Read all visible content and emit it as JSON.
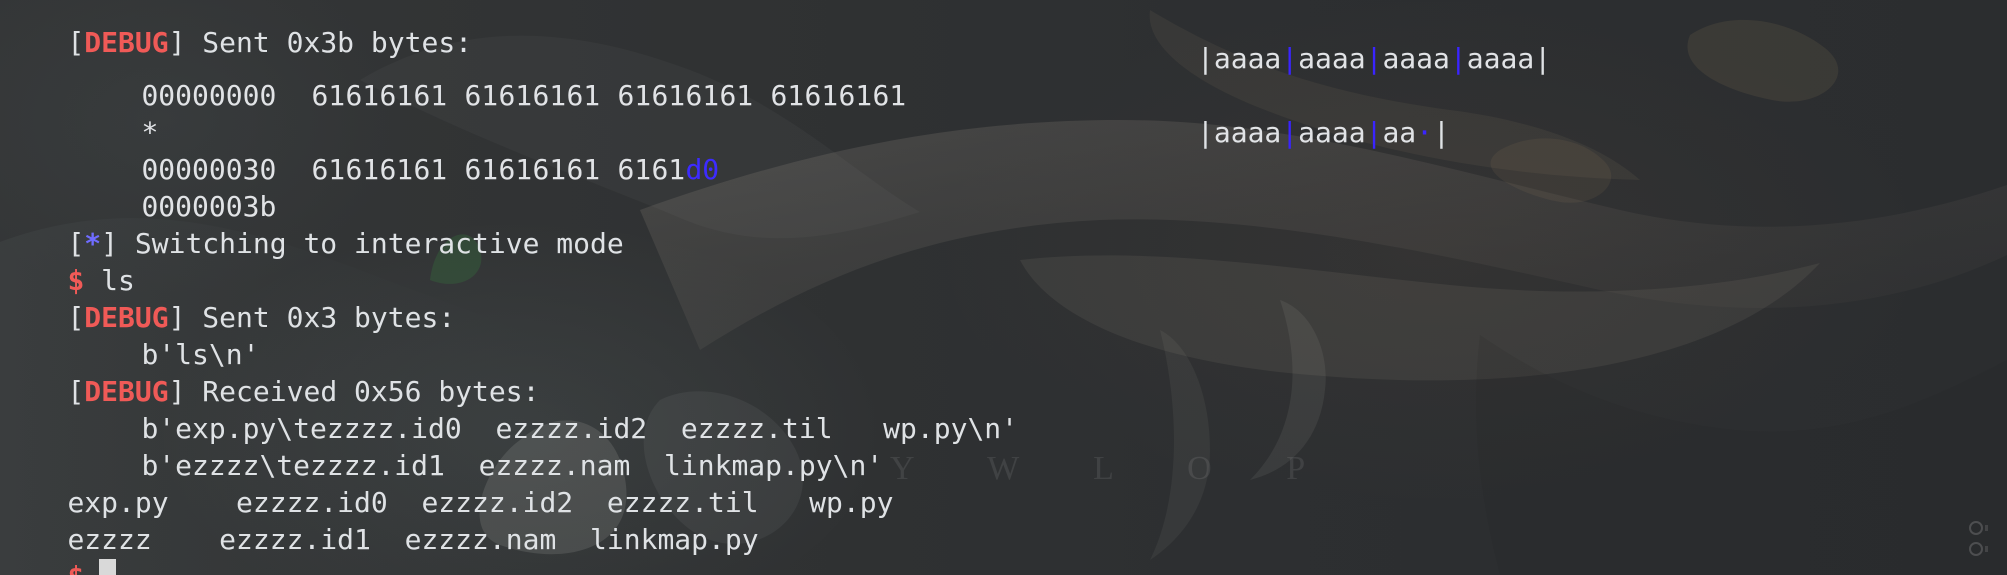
{
  "terminal": {
    "lines": {
      "sent_0x3b": {
        "open": "[",
        "tag": "DEBUG",
        "close": "]",
        "message": " Sent 0x3b bytes:"
      },
      "hex_row_0": {
        "offset": "00000000",
        "bytes_1": [
          "61",
          "61",
          "61",
          "61"
        ],
        "bytes_2": [
          "61",
          "61",
          "61",
          "61"
        ],
        "bytes_3": [
          "61",
          "61",
          "61",
          "61"
        ],
        "bytes_4": [
          "61",
          "61",
          "61",
          "61"
        ],
        "ascii_1": "aaaa",
        "ascii_2": "aaaa",
        "ascii_3": "aaaa",
        "ascii_4": "aaaa"
      },
      "repeat_marker": "*",
      "hex_row_30": {
        "offset": "00000030",
        "bytes_1": [
          "61",
          "61",
          "61",
          "61"
        ],
        "bytes_2": [
          "61",
          "61",
          "61",
          "61"
        ],
        "bytes_3": [
          "61",
          "61"
        ],
        "accent_byte": "d0",
        "ascii_1": "aaaa",
        "ascii_2": "aaaa",
        "ascii_3": "aa",
        "ascii_dot": "·"
      },
      "end_offset": "0000003b",
      "switching": {
        "open": "[",
        "tag": "*",
        "close": "]",
        "message": " Switching to interactive mode"
      },
      "prompt_ls": {
        "prompt": "$",
        "command": " ls"
      },
      "sent_0x3": {
        "open": "[",
        "tag": "DEBUG",
        "close": "]",
        "message": " Sent 0x3 bytes:"
      },
      "payload_ls": "b'ls\\n'",
      "received_0x56": {
        "open": "[",
        "tag": "DEBUG",
        "close": "]",
        "message": " Received 0x56 bytes:"
      },
      "received_line_1": "b'exp.py\\tezzzz.id0  ezzzz.id2  ezzzz.til   wp.py\\n'",
      "received_line_2": "b'ezzzz\\tezzzz.id1  ezzzz.nam  linkmap.py\\n'",
      "ls_output_1": "exp.py    ezzzz.id0  ezzzz.id2  ezzzz.til   wp.py",
      "ls_output_2": "ezzzz    ezzzz.id1  ezzzz.nam  linkmap.py",
      "prompt_final": "$"
    }
  },
  "watermark": "Y  W L O P",
  "icons": {
    "background": "anime-character-wallpaper-art",
    "side": "terminal-side-status-icons"
  },
  "colors": {
    "background": "#2f3133",
    "foreground": "#dfe2e5",
    "debug_tag": "#f05a57",
    "info_tag": "#6f6cff",
    "hex_accent": "#3d2bff",
    "cursor": "#d9d9d9"
  }
}
